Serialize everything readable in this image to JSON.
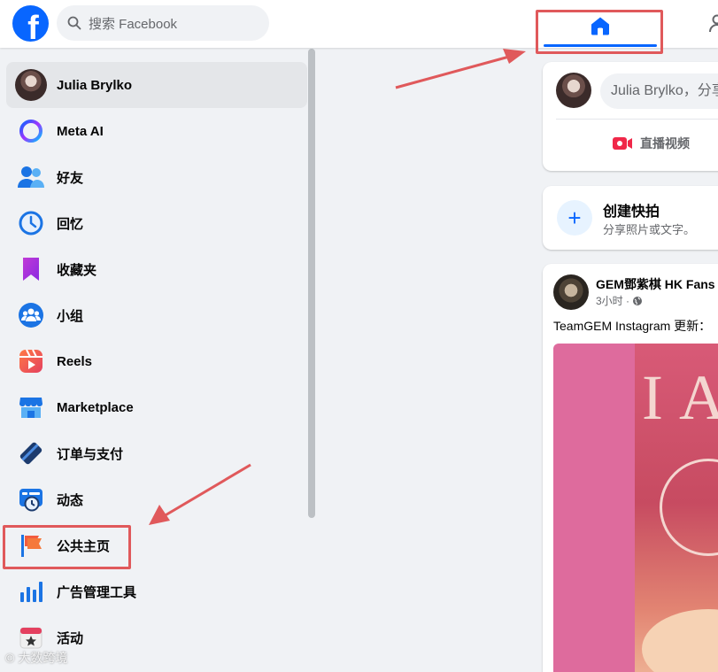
{
  "header": {
    "logo_letter": "f",
    "search_placeholder": "搜索 Facebook"
  },
  "sidebar": {
    "items": [
      {
        "label": "Julia Brylko"
      },
      {
        "label": "Meta AI"
      },
      {
        "label": "好友"
      },
      {
        "label": "回忆"
      },
      {
        "label": "收藏夹"
      },
      {
        "label": "小组"
      },
      {
        "label": "Reels"
      },
      {
        "label": "Marketplace"
      },
      {
        "label": "订单与支付"
      },
      {
        "label": "动态"
      },
      {
        "label": "公共主页"
      },
      {
        "label": "广告管理工具"
      },
      {
        "label": "活动"
      }
    ]
  },
  "composer": {
    "prompt": "Julia Brylko，分享",
    "live_label": "直播视频"
  },
  "story": {
    "title": "创建快拍",
    "subtitle": "分享照片或文字。"
  },
  "post": {
    "author": "GEM鄧紫棋 HK Fans",
    "time": "3小时 ·",
    "text": "TeamGEM Instagram 更新：",
    "image_text": "I AV"
  },
  "watermark": {
    "text": "大数跨境"
  },
  "colors": {
    "brand": "#0866ff",
    "highlight": "#e0595b"
  }
}
